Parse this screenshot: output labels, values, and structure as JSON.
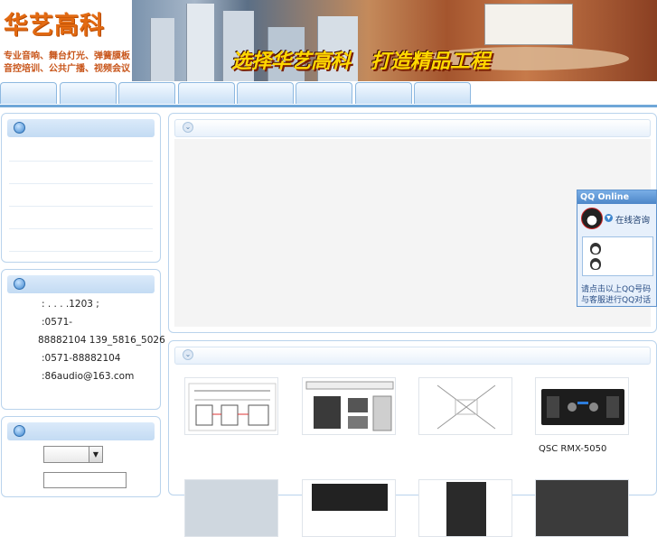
{
  "header": {
    "logo_title": "华艺高科",
    "logo_line1": "专业音响、舞台灯光、弹簧膜板",
    "logo_line2": "音控培训、公共广播、视频会议",
    "banner_slogan": "选择华艺高科　打造精品工程"
  },
  "contact": {
    "address": ": . . . .1203 ;",
    "phone_label": ":0571-",
    "phone_numbers": "88882104 139_5816_5026",
    "fax": ":0571-88882104",
    "email": ":86audio@163.com"
  },
  "products": [
    {
      "caption": ""
    },
    {
      "caption": ""
    },
    {
      "caption": ""
    },
    {
      "caption": "QSC RMX-5050"
    }
  ],
  "qq": {
    "title": "QQ Online",
    "status": "在线咨询",
    "note_line1": "请点击以上QQ号码",
    "note_line2": "与客服进行QQ对话"
  },
  "colors": {
    "brand_orange": "#e26a12",
    "nav_blue": "#6fa7d8",
    "slogan_yellow": "#ffd800"
  }
}
